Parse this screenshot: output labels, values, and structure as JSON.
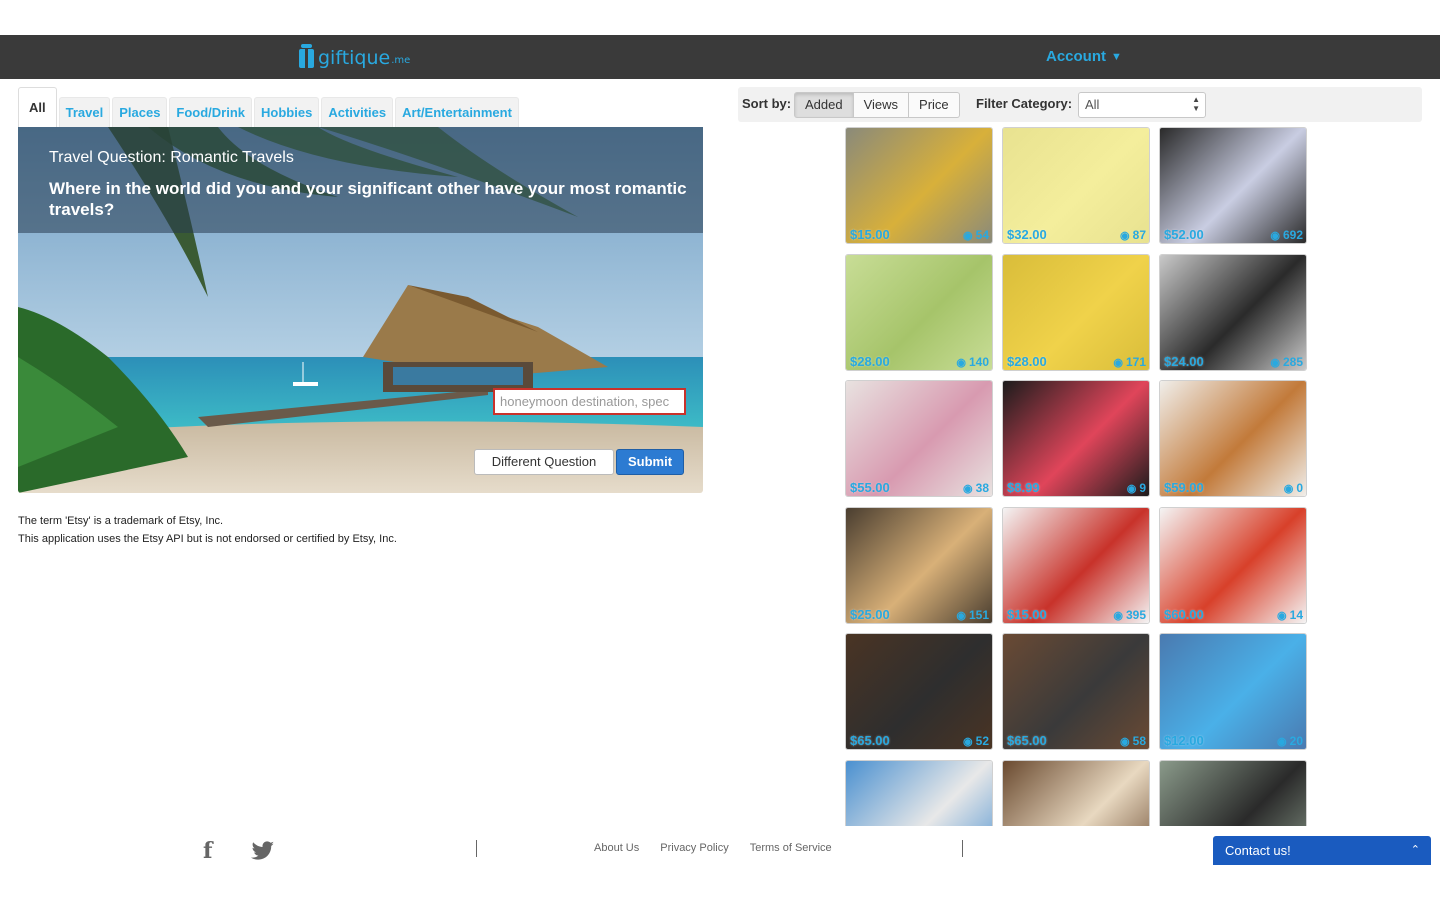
{
  "header": {
    "logo_text": "giftique",
    "logo_suffix": ".me",
    "account_label": "Account"
  },
  "tabs": [
    {
      "label": "All",
      "active": true
    },
    {
      "label": "Travel"
    },
    {
      "label": "Places"
    },
    {
      "label": "Food/Drink"
    },
    {
      "label": "Hobbies"
    },
    {
      "label": "Activities"
    },
    {
      "label": "Art/Entertainment"
    }
  ],
  "question": {
    "title": "Travel Question: Romantic Travels",
    "text": "Where in the world did you and your significant other have your most romantic travels?",
    "input_placeholder": "honeymoon destination, spec",
    "different_label": "Different Question",
    "submit_label": "Submit"
  },
  "legal": {
    "line1": "The term 'Etsy' is a trademark of Etsy, Inc.",
    "line2": "This application uses the Etsy API but is not endorsed or certified by Etsy, Inc."
  },
  "sortbar": {
    "sort_label": "Sort by:",
    "options": [
      "Added",
      "Views",
      "Price"
    ],
    "active": "Added",
    "filter_label": "Filter Category:",
    "filter_value": "All"
  },
  "products": [
    {
      "price": "$15.00",
      "views": "54",
      "colors": [
        "#8a8a7a",
        "#d8b03a"
      ]
    },
    {
      "price": "$32.00",
      "views": "87",
      "colors": [
        "#e8e290",
        "#f4ee9c"
      ]
    },
    {
      "price": "$52.00",
      "views": "692",
      "colors": [
        "#2a2a2a",
        "#c9cde2"
      ]
    },
    {
      "price": "$28.00",
      "views": "140",
      "colors": [
        "#c8dd96",
        "#a6c46a"
      ]
    },
    {
      "price": "$28.00",
      "views": "171",
      "colors": [
        "#d9bd3a",
        "#f0d24a"
      ]
    },
    {
      "price": "$24.00",
      "views": "285",
      "colors": [
        "#c9c9c9",
        "#2a2a2a"
      ]
    },
    {
      "price": "$55.00",
      "views": "38",
      "colors": [
        "#e8e2e0",
        "#d89ab0"
      ]
    },
    {
      "price": "$8.99",
      "views": "9",
      "colors": [
        "#1c1c1c",
        "#e0455a"
      ]
    },
    {
      "price": "$59.00",
      "views": "0",
      "colors": [
        "#f0eeea",
        "#c27a3a"
      ]
    },
    {
      "price": "$25.00",
      "views": "151",
      "colors": [
        "#4a3e30",
        "#d8b078"
      ]
    },
    {
      "price": "$15.00",
      "views": "395",
      "colors": [
        "#f4f4f4",
        "#c8322a"
      ]
    },
    {
      "price": "$60.00",
      "views": "14",
      "colors": [
        "#f4f4f4",
        "#d8402a"
      ]
    },
    {
      "price": "$65.00",
      "views": "52",
      "colors": [
        "#4a3424",
        "#2e2e2e"
      ]
    },
    {
      "price": "$65.00",
      "views": "58",
      "colors": [
        "#6a4a34",
        "#3a3a3a"
      ]
    },
    {
      "price": "$12.00",
      "views": "20",
      "colors": [
        "#4a7ab0",
        "#4ab0e8"
      ]
    },
    {
      "price": "",
      "views": "",
      "colors": [
        "#4a90d0",
        "#e8e8e8"
      ]
    },
    {
      "price": "",
      "views": "",
      "colors": [
        "#6a4a30",
        "#e8d8c0"
      ]
    },
    {
      "price": "",
      "views": "",
      "colors": [
        "#8a9a8a",
        "#2a2a2a"
      ]
    }
  ],
  "footer": {
    "links": [
      "About Us",
      "Privacy Policy",
      "Terms of Service"
    ],
    "contact_label": "Contact us!"
  },
  "colors": {
    "accent": "#29a9e0",
    "topbar": "#3a3a3a",
    "submit": "#2c7bd2",
    "contact": "#1a5bbf"
  }
}
